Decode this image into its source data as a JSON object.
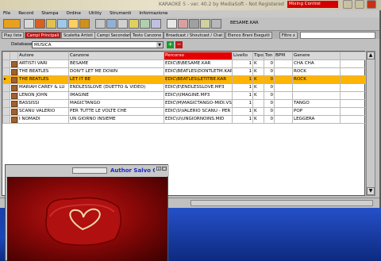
{
  "window": {
    "title": "KARAOKE 5 - ver. 40.2 by MediaSoft - Not Registered",
    "mixing_control": "Mixing Control"
  },
  "menu": [
    "File",
    "Record",
    "Stampa",
    "Ordine",
    "Utility",
    "Strumenti",
    "Informazione"
  ],
  "toolbar": {
    "current_song": "BESAME.KAR"
  },
  "tabs": [
    "Play liste",
    "Campi Principali",
    "Scaletta Artisti",
    "Campi Secondari",
    "Testo Canzone",
    "Broadcast / Shoutcast / Chat",
    "Elenco Brani Eseguiti",
    "Filtro x"
  ],
  "database": {
    "label": "Database :",
    "value": "MUSICA"
  },
  "table": {
    "columns": [
      "Autore",
      "Canzone",
      "Percorso",
      "Livello",
      "Tipo",
      "Ton",
      "BPM",
      "Genere"
    ],
    "rows": [
      [
        "ARTISTI VARI",
        "BESAME",
        "EDIC\\B\\BESAME.KAR",
        "1",
        "K",
        "0",
        "",
        "CHA CHA"
      ],
      [
        "THE BEATLES",
        "DON'T LET ME DOWN",
        "EDIC\\BEATLES\\DONTLETM.KAR",
        "1",
        "K",
        "0",
        "",
        "ROCK"
      ],
      [
        "THE BEATLES",
        "LET IT BE",
        "EDIC\\BEATLES\\LETITBE.KAR",
        "1",
        "K",
        "0",
        "",
        "ROCK"
      ],
      [
        "MARIAH CAREY & LU",
        "ENDLESSLOVE (DUETTO & VIDEO)",
        "EDIC\\E\\ENDLESSLOVE.MP3",
        "1",
        "K",
        "0",
        "",
        ""
      ],
      [
        "LENON JOHN",
        "IMAGINE",
        "EDIC\\I\\IMAGINE.MP3",
        "1",
        "K",
        "0",
        "",
        ""
      ],
      [
        "BASSISSI",
        "MAGICTANGO",
        "EDIC\\M\\MAGICTANGO-MIDI.VS",
        "1",
        "",
        "0",
        "",
        "TANGO"
      ],
      [
        "SCANU VALERIO",
        "PER TUTTE LE VOLTE CHE",
        "EDIC\\S\\VALERIO SCANU - PER",
        "1",
        "K",
        "0",
        "",
        "POP"
      ],
      [
        "I NOMADI",
        "UN GIORNO INSIEME",
        "EDIC\\U\\UNGIORNOINS.MID",
        "1",
        "K",
        "0",
        "",
        "LEGGERA"
      ]
    ],
    "selected_row": 2
  },
  "video": {
    "author": "Author Salvo Gile"
  }
}
